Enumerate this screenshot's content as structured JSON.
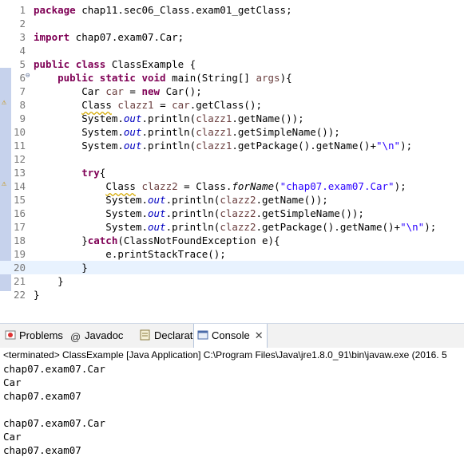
{
  "editor": {
    "lines": [
      {
        "n": "1",
        "t": "package chap11.sec06_Class.exam01_getClass;"
      },
      {
        "n": "2",
        "t": ""
      },
      {
        "n": "3",
        "t": "import chap07.exam07.Car;"
      },
      {
        "n": "4",
        "t": ""
      },
      {
        "n": "5",
        "t": "public class ClassExample {"
      },
      {
        "n": "6",
        "t": "    public static void main(String[] args){"
      },
      {
        "n": "7",
        "t": "        Car car = new Car();"
      },
      {
        "n": "8",
        "t": "        Class clazz1 = car.getClass();"
      },
      {
        "n": "9",
        "t": "        System.out.println(clazz1.getName());"
      },
      {
        "n": "10",
        "t": "        System.out.println(clazz1.getSimpleName());"
      },
      {
        "n": "11",
        "t": "        System.out.println(clazz1.getPackage().getName()+\"\\n\");"
      },
      {
        "n": "12",
        "t": ""
      },
      {
        "n": "13",
        "t": "        try{"
      },
      {
        "n": "14",
        "t": "            Class clazz2 = Class.forName(\"chap07.exam07.Car\");"
      },
      {
        "n": "15",
        "t": "            System.out.println(clazz2.getName());"
      },
      {
        "n": "16",
        "t": "            System.out.println(clazz2.getSimpleName());"
      },
      {
        "n": "17",
        "t": "            System.out.println(clazz2.getPackage().getName()+\"\\n\");"
      },
      {
        "n": "18",
        "t": "        }catch(ClassNotFoundException e){"
      },
      {
        "n": "19",
        "t": "            e.printStackTrace();"
      },
      {
        "n": "20",
        "t": "        }"
      },
      {
        "n": "21",
        "t": "    }"
      },
      {
        "n": "22",
        "t": "}"
      }
    ]
  },
  "tabs": [
    {
      "label": "Problems",
      "icon": "problems-icon"
    },
    {
      "label": "Javadoc",
      "icon": "javadoc-icon"
    },
    {
      "label": "Declaration",
      "icon": "declaration-icon"
    },
    {
      "label": "Console",
      "icon": "console-icon",
      "active": true
    }
  ],
  "console": {
    "status": "<terminated> ClassExample [Java Application] C:\\Program Files\\Java\\jre1.8.0_91\\bin\\javaw.exe (2016. 5",
    "output": [
      "chap07.exam07.Car",
      "Car",
      "chap07.exam07",
      "",
      "chap07.exam07.Car",
      "Car",
      "chap07.exam07"
    ]
  },
  "colors": {
    "keyword": "#7f0055",
    "string": "#2a00ff",
    "field": "#0000c0",
    "local": "#6a3e3e"
  }
}
